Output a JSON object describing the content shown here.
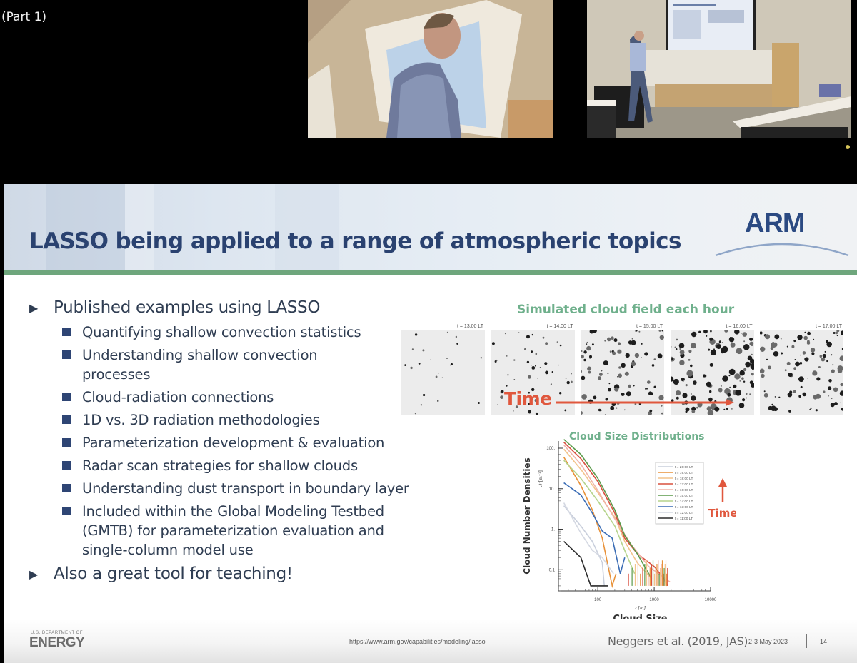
{
  "overlay": {
    "part_label": "(Part 1)"
  },
  "videos": [
    {
      "name": "speaker-closeup-feed",
      "description": "close-up of presenter in checked shirt looking at projector screen"
    },
    {
      "name": "classroom-wide-feed",
      "description": "wide shot of presenter pointing at projected slide in classroom"
    }
  ],
  "slide": {
    "title": "LASSO being applied to a range of atmospheric topics",
    "logo": "ARM",
    "colors": {
      "title": "#2a4270",
      "accent_green": "#6ea67c",
      "figure_title_green": "#6fb08c",
      "time_red": "#e0573d",
      "bullet_square": "#2e4574"
    },
    "bullets": [
      {
        "text": "Published examples using LASSO",
        "sub": [
          "Quantifying shallow convection statistics",
          "Understanding shallow convection processes",
          "Cloud-radiation connections",
          "1D vs. 3D radiation methodologies",
          "Parameterization development & evaluation",
          "Radar scan strategies for shallow clouds",
          "Understanding dust transport in boundary layer",
          "Included within the Global Modeling Testbed (GMTB) for parameterization evaluation and single-column model use"
        ]
      },
      {
        "text": "Also a great tool for teaching!",
        "sub": []
      }
    ],
    "cloud_figure": {
      "title": "Simulated cloud field each hour",
      "panels": [
        "t = 13:00 LT",
        "t = 14:00 LT",
        "t = 15:00 LT",
        "t = 16:00 LT",
        "t = 17:00 LT"
      ],
      "cloud_cover_relative": [
        0.05,
        0.25,
        0.55,
        0.75,
        0.6
      ],
      "arrow_label": "Time"
    },
    "footer": {
      "agency_small": "U.S. DEPARTMENT OF",
      "agency": "ENERGY",
      "url": "https://www.arm.gov/capabilities/modeling/lasso",
      "citation": "Neggers et al. (2019, JAS)",
      "date": "2-3 May 2023",
      "page": "14"
    }
  },
  "chart_data": {
    "type": "line",
    "title": "Cloud Size Distributions",
    "xlabel": "Cloud Size",
    "xlabel_sub": "ℓ [m]",
    "ylabel": "Cloud Number Densities",
    "ylabel_sub": "𝒩 [m⁻¹]",
    "xscale": "log",
    "yscale": "log",
    "xlim": [
      20,
      10000
    ],
    "ylim": [
      0.03,
      150
    ],
    "xticks": [
      100,
      1000,
      10000
    ],
    "xtick_labels": [
      "100",
      "1000",
      "10000"
    ],
    "yticks": [
      0.1,
      1,
      10,
      100
    ],
    "ytick_labels": [
      "0.1",
      "1.",
      "10.",
      "100."
    ],
    "legend_position": "upper-right",
    "annotation": "Time",
    "series": [
      {
        "name": "t = 20:00 LT",
        "color": "#c9cfdc",
        "x": [
          25,
          50,
          80,
          120,
          130
        ],
        "y": [
          3.8,
          1.2,
          0.5,
          0.15,
          0.04
        ]
      },
      {
        "name": "t = 19:00 LT",
        "color": "#e8923a",
        "x": [
          25,
          50,
          80,
          120,
          180,
          210
        ],
        "y": [
          60,
          12,
          3,
          0.6,
          0.04,
          0.08
        ]
      },
      {
        "name": "t = 18:00 LT",
        "color": "#f3c48c",
        "x": [
          25,
          50,
          100,
          200,
          300,
          500,
          900
        ],
        "y": [
          95,
          30,
          8,
          2,
          0.5,
          0.15,
          0.06
        ]
      },
      {
        "name": "t = 17:00 LT",
        "color": "#d8503f",
        "x": [
          25,
          50,
          100,
          200,
          300,
          500,
          1000,
          1500,
          1700
        ],
        "y": [
          140,
          55,
          15,
          2.5,
          0.6,
          0.25,
          0.12,
          0.06,
          0.04
        ]
      },
      {
        "name": "t = 16:00 LT",
        "color": "#f0b3a8",
        "x": [
          25,
          50,
          100,
          200,
          400,
          800,
          1900
        ],
        "y": [
          120,
          40,
          9,
          1.8,
          0.4,
          0.12,
          0.05
        ]
      },
      {
        "name": "t = 15:00 LT",
        "color": "#5a9a4a",
        "x": [
          25,
          50,
          100,
          200,
          300,
          500,
          900
        ],
        "y": [
          165,
          70,
          18,
          3,
          0.7,
          0.25,
          0.06
        ]
      },
      {
        "name": "t = 14:00 LT",
        "color": "#b6d48c",
        "x": [
          25,
          50,
          100,
          200,
          300,
          450
        ],
        "y": [
          50,
          18,
          5,
          1.2,
          0.3,
          0.08
        ]
      },
      {
        "name": "t = 13:00 LT",
        "color": "#3a6cb5",
        "x": [
          25,
          50,
          80,
          120,
          180,
          250,
          300
        ],
        "y": [
          14,
          7,
          2.5,
          0.9,
          0.6,
          0.08,
          0.2
        ]
      },
      {
        "name": "t = 12:00 LT",
        "color": "#d4d8e2",
        "x": [
          25,
          50,
          80,
          120,
          190
        ],
        "y": [
          4.5,
          0.8,
          0.3,
          0.2,
          0.08
        ]
      },
      {
        "name": "t = 11:00 LT",
        "color": "#2b2b2b",
        "x": [
          25,
          50,
          75,
          150
        ],
        "y": [
          0.5,
          0.2,
          0.04,
          0.04
        ]
      }
    ]
  }
}
